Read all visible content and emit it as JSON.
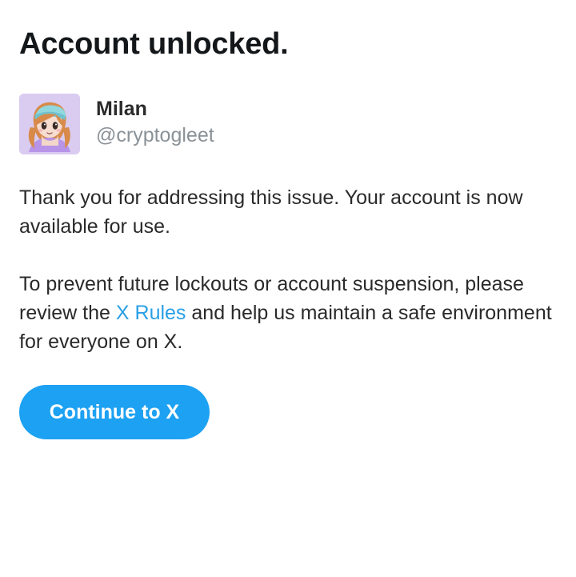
{
  "page": {
    "title": "Account unlocked."
  },
  "user": {
    "name": "Milan",
    "handle": "@cryptogleet",
    "avatar_icon": "anime-girl-avatar-icon",
    "avatar_background": "#d9ccf0"
  },
  "message": {
    "paragraph1": "Thank you for addressing this issue. Your account is now available for use.",
    "paragraph2_prefix": "To prevent future lockouts or account suspension, please review the ",
    "paragraph2_link": "X Rules",
    "paragraph2_suffix": " and help us maintain a safe environment for everyone on X."
  },
  "actions": {
    "continue_label": "Continue to X"
  },
  "colors": {
    "accent": "#1da1f2",
    "link": "#2a9fe6",
    "text": "#14171a",
    "muted": "#8a9298"
  }
}
